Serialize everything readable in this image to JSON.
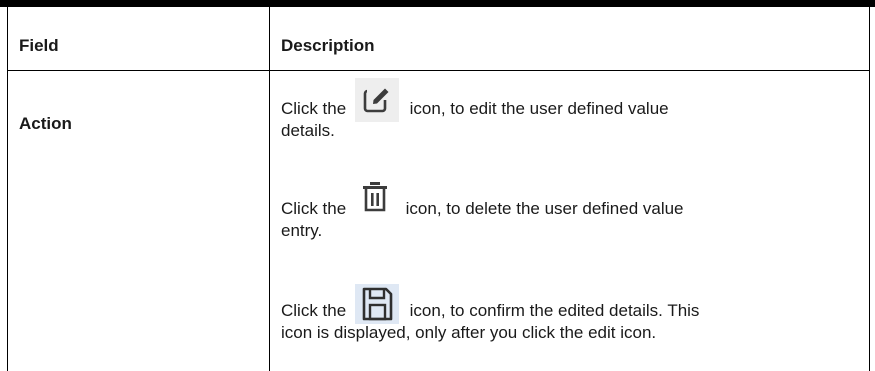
{
  "table": {
    "headers": {
      "field": "Field",
      "description": "Description"
    },
    "row": {
      "field": "Action",
      "entries": [
        {
          "icon": "edit-icon",
          "before": "Click the",
          "after_line1": "icon, to edit the user defined value",
          "after_line2": "details."
        },
        {
          "icon": "delete-icon",
          "before": "Click the",
          "after_line1": "icon, to delete the user defined value",
          "after_line2": "entry."
        },
        {
          "icon": "save-icon",
          "before": "Click the",
          "after_line1": "icon, to confirm the edited details. This",
          "after_line2": "icon is displayed, only after you click the edit icon."
        }
      ]
    }
  },
  "colors": {
    "rule": "#000000",
    "text": "#1a1a1a",
    "icon_stroke": "#3c3c3c",
    "edit_icon_bg": "#eeeeee",
    "save_icon_bg": "#dfe8f4"
  }
}
